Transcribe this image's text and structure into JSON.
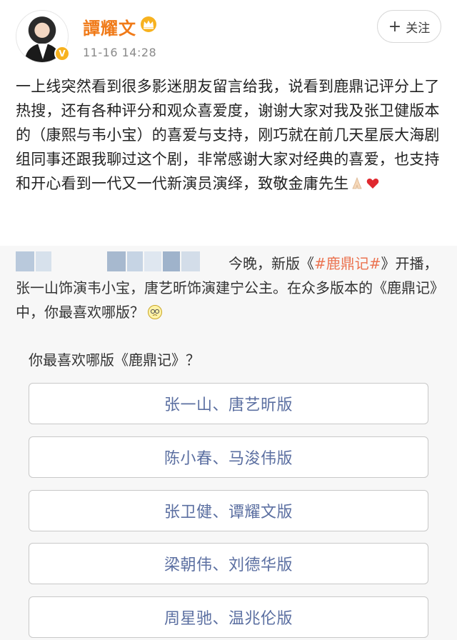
{
  "post": {
    "author": {
      "name": "譚耀文",
      "time": "11-16 14:28"
    },
    "follow_label": "关注",
    "text": "一上线突然看到很多影迷朋友留言给我，说看到鹿鼎记评分上了热搜，还有各种评分和观众喜爱度，谢谢大家对我及张卫健版本的（康熙与韦小宝）的喜爱与支持，刚巧就在前几天星辰大海剧组同事还跟我聊过这个剧，非常感谢大家对经典的喜爱，也支持和开心看到一代又一代新演员演绎，致敬金庸先生"
  },
  "repost": {
    "text_part1": "今晚，新版《",
    "hashtag": "#鹿鼎记#",
    "text_part2": "》开播，张一山饰演韦小宝，唐艺昕饰演建宁公主。在众多版本的《鹿鼎记》中，你最喜欢哪版？",
    "poll": {
      "title": "你最喜欢哪版《鹿鼎记》？",
      "options": [
        "张一山、唐艺昕版",
        "陈小春、马浚伟版",
        "张卫健、谭耀文版",
        "梁朝伟、刘德华版",
        "周星驰、温兆伦版"
      ]
    }
  },
  "colors": {
    "name": "#f07a18",
    "hashtag": "#eb7350",
    "option_text": "#5b6fa1",
    "repost_bg": "#f7f7f7"
  },
  "icons": {
    "verified": "verified-badge-icon",
    "crown": "crown-icon",
    "pray": "praying-hands-emoji",
    "heart": "red-heart-emoji",
    "think": "thinking-face-emoji"
  }
}
